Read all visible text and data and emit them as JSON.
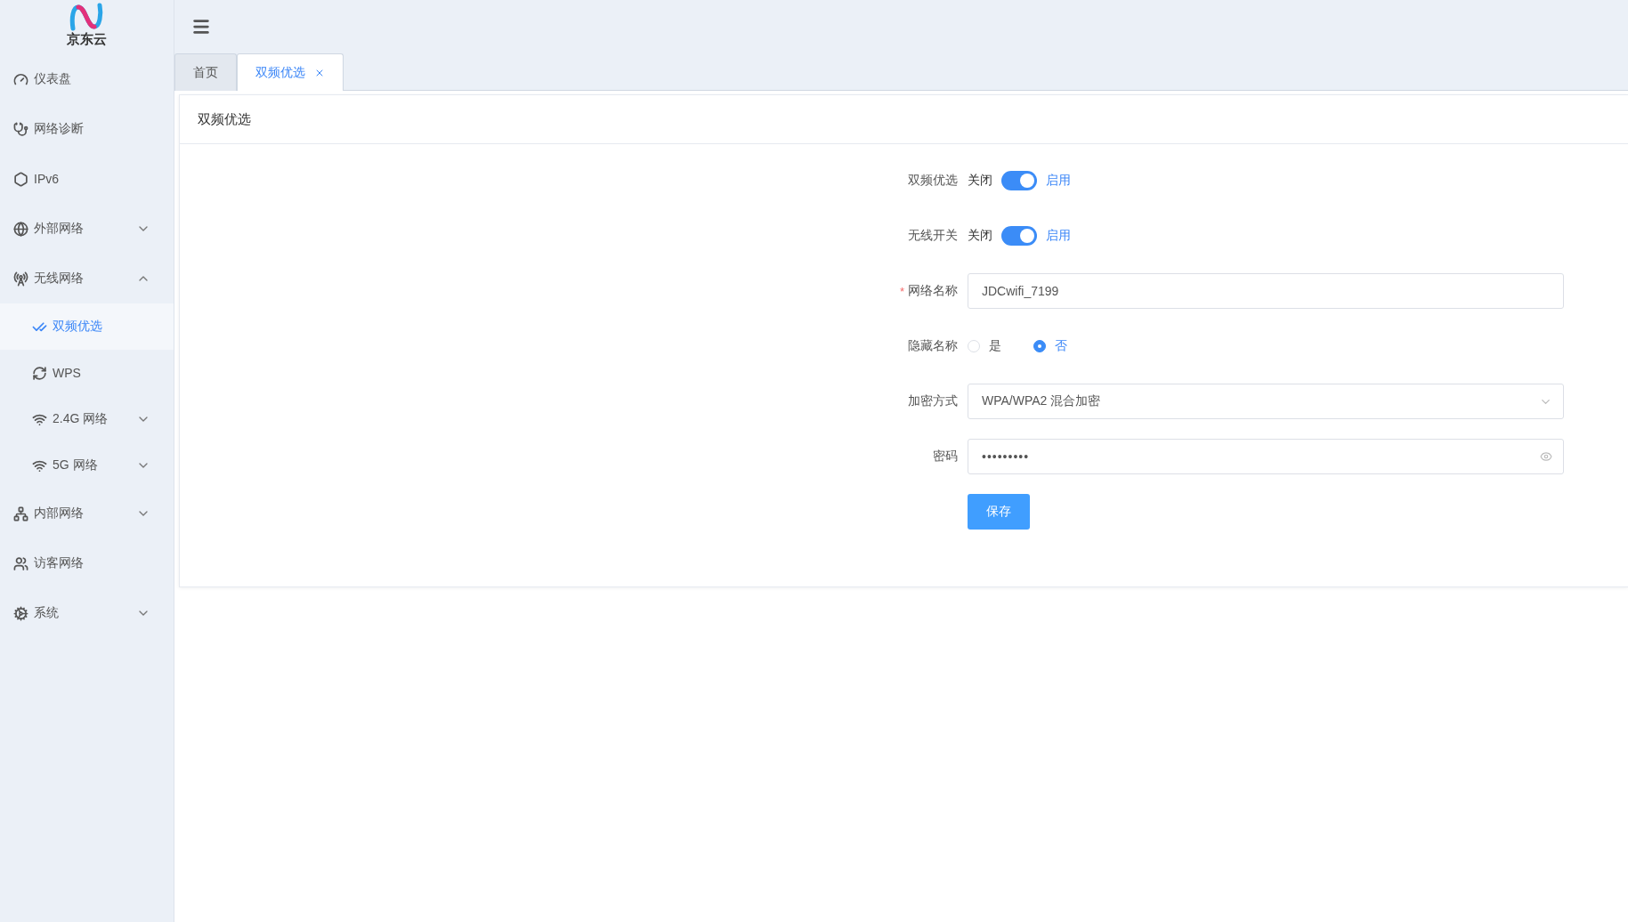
{
  "logo": {
    "text": "京东云"
  },
  "sidebar": {
    "items": [
      {
        "label": "仪表盘",
        "selected": false
      },
      {
        "label": "网络诊断",
        "selected": false
      },
      {
        "label": "IPv6",
        "selected": false
      },
      {
        "label": "外部网络",
        "selected": false,
        "expanded": false
      },
      {
        "label": "无线网络",
        "selected": false,
        "expanded": true,
        "children": [
          {
            "label": "双频优选",
            "selected": true
          },
          {
            "label": "WPS",
            "selected": false
          },
          {
            "label": "2.4G 网络",
            "selected": false,
            "expanded": false
          },
          {
            "label": "5G 网络",
            "selected": false,
            "expanded": false
          }
        ]
      },
      {
        "label": "内部网络",
        "selected": false,
        "expanded": false
      },
      {
        "label": "访客网络",
        "selected": false
      },
      {
        "label": "系统",
        "selected": false,
        "expanded": false
      }
    ]
  },
  "tabs": [
    {
      "label": "首页",
      "selected": false,
      "closable": false
    },
    {
      "label": "双频优选",
      "selected": true,
      "closable": true
    }
  ],
  "card": {
    "title": "双频优选",
    "fields": [
      {
        "kind": "switch",
        "label": "双频优选",
        "off_label": "关闭",
        "on_label": "启用",
        "on": true
      },
      {
        "kind": "switch",
        "label": "无线开关",
        "off_label": "关闭",
        "on_label": "启用",
        "on": true
      },
      {
        "kind": "text",
        "label": "网络名称",
        "required_mark": "*",
        "value": "JDCwifi_7199"
      },
      {
        "kind": "radio",
        "label": "隐藏名称",
        "options": [
          {
            "label": "是",
            "selected": false
          },
          {
            "label": "否",
            "selected": true
          }
        ]
      },
      {
        "kind": "select",
        "label": "加密方式",
        "value": "WPA/WPA2 混合加密"
      },
      {
        "kind": "password",
        "label": "密码",
        "value": "•••••••••"
      },
      {
        "kind": "button",
        "label": "保存"
      }
    ]
  }
}
